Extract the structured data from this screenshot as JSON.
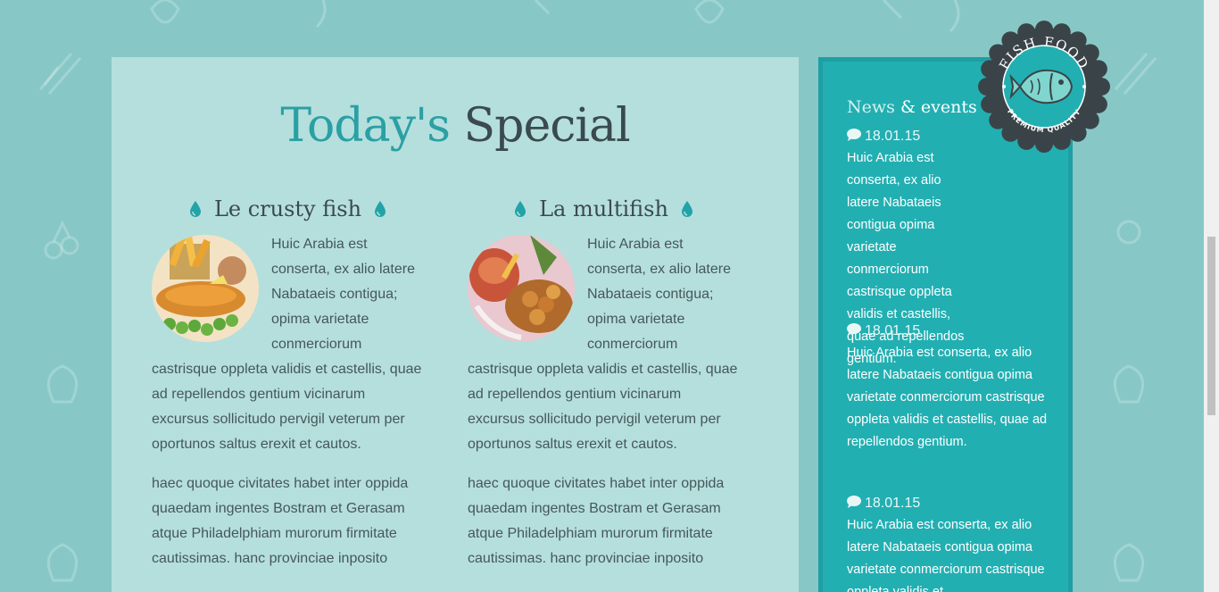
{
  "special": {
    "title_accent": "Today's",
    "title_rest": "Special"
  },
  "dishes": [
    {
      "name": "Le crusty fish",
      "paragraph1": "Huic Arabia est conserta, ex alio latere Nabataeis contigua; opima varietate conmerciorum castrisque oppleta validis et castellis, quae ad repellendos gentium vicinarum excursus sollicitudo pervigil veterum per oportunos saltus erexit et cautos.",
      "paragraph2": "haec quoque civitates habet inter oppida quaedam ingentes Bostram et Gerasam atque Philadelphiam murorum firmitate cautissimas. hanc provinciae inposito"
    },
    {
      "name": "La multifish",
      "paragraph1": "Huic Arabia est conserta, ex alio latere Nabataeis contigua; opima varietate conmerciorum castrisque oppleta validis et castellis, quae ad repellendos gentium vicinarum excursus sollicitudo pervigil veterum per oportunos saltus erexit et cautos.",
      "paragraph2": "haec quoque civitates habet inter oppida quaedam ingentes Bostram et Gerasam atque Philadelphiam murorum firmitate cautissimas. hanc provinciae inposito"
    }
  ],
  "news": {
    "title_news": "News",
    "title_events": "& events",
    "items": [
      {
        "date": "18.01.15",
        "text": "Huic Arabia est conserta, ex alio latere Nabataeis contigua opima varietate conmerciorum castrisque oppleta validis et castellis, quae ad repellendos gentium."
      },
      {
        "date": "18.01.15",
        "text": "Huic Arabia est conserta, ex alio latere Nabataeis contigua opima varietate conmerciorum castrisque oppleta validis et castellis, quae ad repellendos gentium."
      },
      {
        "date": "18.01.15",
        "text": "Huic Arabia est conserta, ex alio latere Nabataeis contigua opima varietate conmerciorum castrisque oppleta validis et"
      }
    ]
  },
  "badge": {
    "top_text": "FISH FOOD",
    "bottom_text": "PREMIUM QUALITY"
  },
  "icons": {
    "drop": "water-drop-icon",
    "comment": "speech-bubble-icon",
    "badge": "fish-icon"
  },
  "colors": {
    "background": "#87c8c6",
    "panel": "#b5dfdd",
    "accent": "#2aa0a4",
    "news_panel": "#22afb2",
    "badge_dark": "#3a4448"
  }
}
